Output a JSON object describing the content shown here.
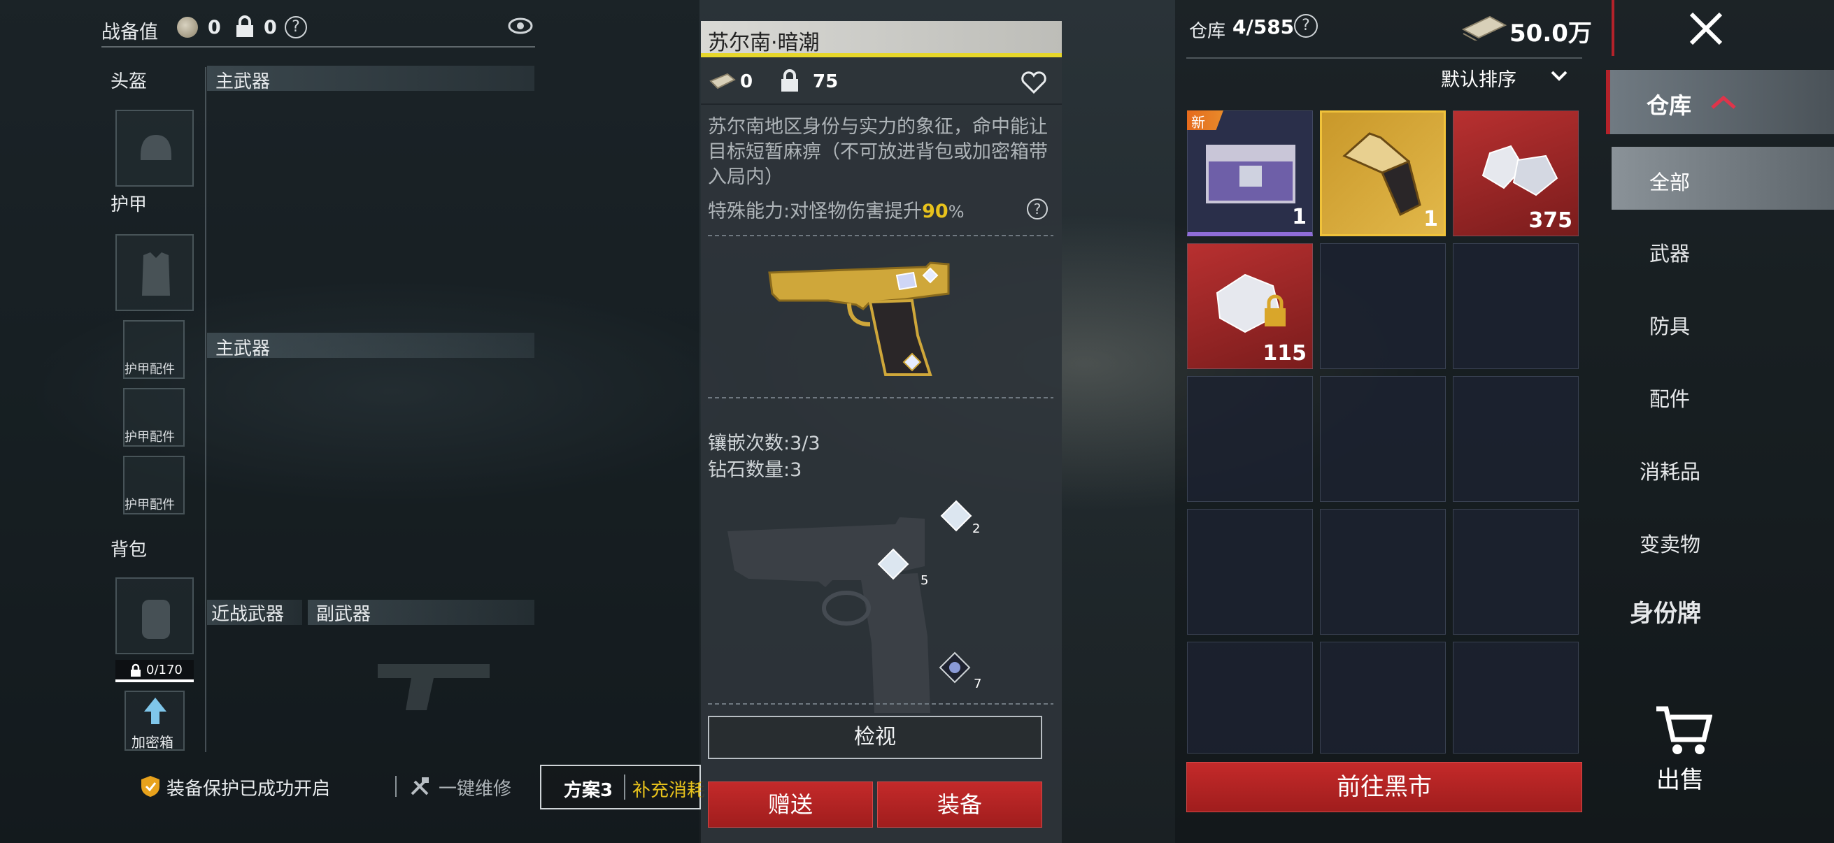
{
  "top_left": {
    "title": "战备值",
    "coin_value": "0",
    "lock_value": "0"
  },
  "loadout": {
    "helmet": "头盔",
    "armor": "护甲",
    "backpack": "背包",
    "primary1": "主武器",
    "primary2": "主武器",
    "melee": "近战武器",
    "secondary": "副武器",
    "armor_parts": [
      "护甲配件",
      "护甲配件",
      "护甲配件"
    ],
    "capacity": "0/170",
    "safe_box": "加密箱"
  },
  "bottom_bar": {
    "protection": "装备保护已成功开启",
    "repair": "一键维修",
    "plan": "方案3",
    "refill": "补充消耗"
  },
  "detail": {
    "title": "苏尔南·暗潮",
    "coin_value": "0",
    "lock_value": "75",
    "description": "苏尔南地区身份与实力的象征，命中能让目标短暂麻痹（不可放进背包或加密箱带入局内）",
    "ability_prefix": "特殊能力:对怪物伤害提升",
    "ability_value": "90",
    "ability_unit": "%",
    "inlay": "镶嵌次数:3/3",
    "diamonds": "钻石数量:3",
    "diamond_slots": [
      "2",
      "5",
      "7"
    ],
    "inspect": "检视",
    "gift": "赠送",
    "equip": "装备"
  },
  "warehouse": {
    "label": "仓库",
    "capacity": "4/585",
    "money": "50.0万",
    "sort": "默认排序",
    "new_badge": "新",
    "items": [
      {
        "icon": "crate-icon",
        "count": "1"
      },
      {
        "icon": "golden-pistol-icon",
        "count": "1"
      },
      {
        "icon": "diamond-pile-icon",
        "count": "375"
      },
      {
        "icon": "locked-diamond-icon",
        "count": "115"
      }
    ],
    "black_market": "前往黑市"
  },
  "nav": {
    "warehouse": "仓库",
    "items": [
      "全部",
      "武器",
      "防具",
      "配件",
      "消耗品",
      "变卖物",
      "身份牌"
    ],
    "sell": "出售"
  },
  "colors": {
    "accent_red": "#b4222a",
    "accent_yellow": "#e6d62a",
    "gold": "#d9a62a"
  }
}
